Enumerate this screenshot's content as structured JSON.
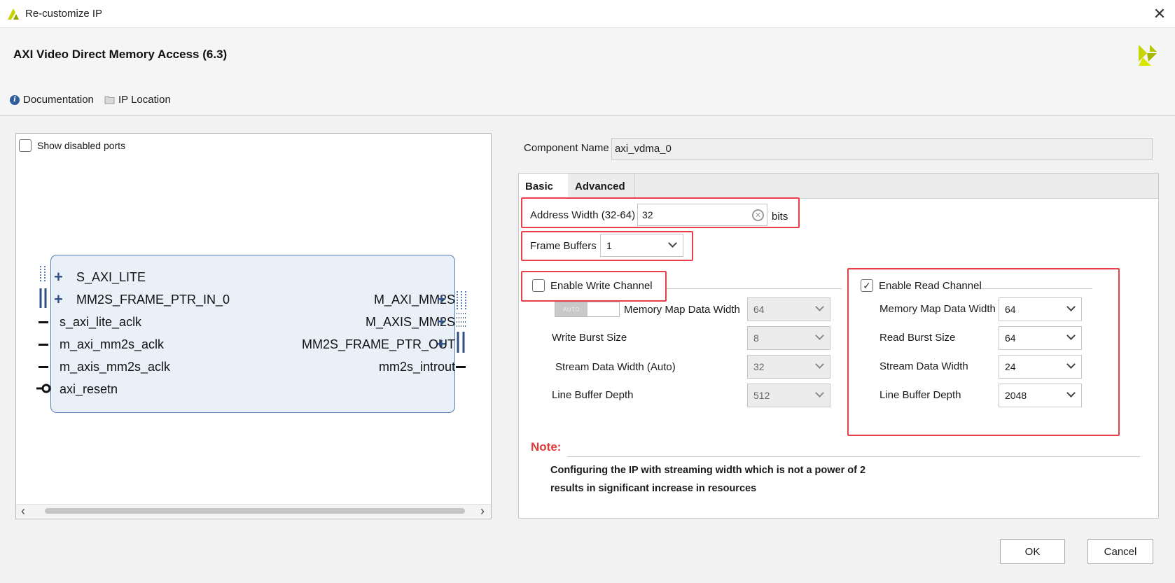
{
  "window": {
    "title": "Re-customize IP",
    "close_glyph": "✕"
  },
  "header": {
    "ip_title": "AXI Video Direct Memory Access (6.3)",
    "documentation_label": "Documentation",
    "ip_location_label": "IP Location",
    "brand_color": "#c8d400"
  },
  "symbol": {
    "show_disabled_label": "Show disabled ports",
    "show_disabled_checked": false,
    "left_ports": [
      {
        "name": "S_AXI_LITE",
        "kind": "bus"
      },
      {
        "name": "MM2S_FRAME_PTR_IN_0",
        "kind": "bus"
      },
      {
        "name": "s_axi_lite_aclk",
        "kind": "wire"
      },
      {
        "name": "m_axi_mm2s_aclk",
        "kind": "wire"
      },
      {
        "name": "m_axis_mm2s_aclk",
        "kind": "wire"
      },
      {
        "name": "axi_resetn",
        "kind": "reset"
      }
    ],
    "right_ports": [
      {
        "name": "M_AXI_MM2S",
        "kind": "bus"
      },
      {
        "name": "M_AXIS_MM2S",
        "kind": "bus"
      },
      {
        "name": "MM2S_FRAME_PTR_OUT",
        "kind": "bus"
      },
      {
        "name": "mm2s_introut",
        "kind": "wire"
      }
    ],
    "scroll_left": "‹",
    "scroll_right": "›"
  },
  "config": {
    "component_name_label": "Component Name",
    "component_name_value": "axi_vdma_0",
    "tabs": [
      {
        "label": "Basic",
        "active": true
      },
      {
        "label": "Advanced",
        "active": false
      }
    ],
    "address_width_label": "Address Width (32-64)",
    "address_width_value": "32",
    "address_width_unit": "bits",
    "frame_buffers_label": "Frame Buffers",
    "frame_buffers_value": "1",
    "write_channel": {
      "label": "Enable Write Channel",
      "checked": false,
      "auto_label": "AUTO",
      "fields": [
        {
          "label": "Memory Map Data Width",
          "value": "64"
        },
        {
          "label": "Write Burst Size",
          "value": "8"
        },
        {
          "label": "Stream Data Width (Auto)",
          "value": "32"
        },
        {
          "label": "Line Buffer Depth",
          "value": "512"
        }
      ]
    },
    "read_channel": {
      "label": "Enable Read Channel",
      "checked": true,
      "check_glyph": "✓",
      "fields": [
        {
          "label": "Memory Map Data Width",
          "value": "64"
        },
        {
          "label": "Read Burst Size",
          "value": "64"
        },
        {
          "label": "Stream Data Width",
          "value": "24"
        },
        {
          "label": "Line Buffer Depth",
          "value": "2048"
        }
      ]
    },
    "note_title": "Note:",
    "note_line1": "Configuring the IP with streaming width which is not a power of 2",
    "note_line2": "results in significant increase in resources",
    "highlight_color": "#e8404a"
  },
  "footer": {
    "ok_label": "OK",
    "cancel_label": "Cancel"
  }
}
